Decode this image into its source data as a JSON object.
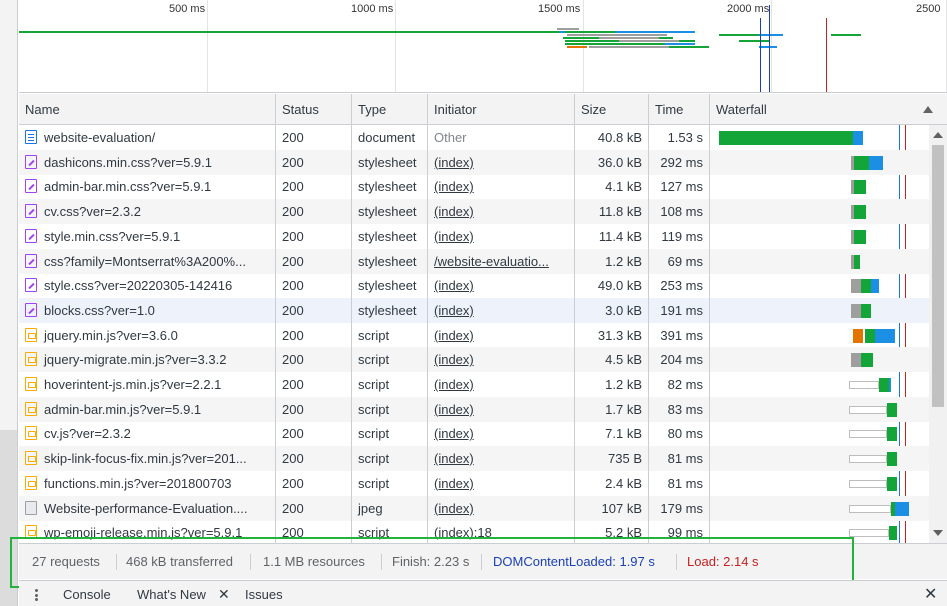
{
  "overview": {
    "ticks": [
      "500 ms",
      "1000 ms",
      "1500 ms",
      "2000 ms",
      "2500"
    ]
  },
  "columns": {
    "name": "Name",
    "status": "Status",
    "type": "Type",
    "initiator": "Initiator",
    "size": "Size",
    "time": "Time",
    "waterfall": "Waterfall"
  },
  "rows": [
    {
      "name": "website-evaluation/",
      "status": "200",
      "type": "document",
      "initiator": "Other",
      "size": "40.8 kB",
      "time": "1.53 s",
      "icon": "document-icon"
    },
    {
      "name": "dashicons.min.css?ver=5.9.1",
      "status": "200",
      "type": "stylesheet",
      "initiator": "(index)",
      "size": "36.0 kB",
      "time": "292 ms",
      "icon": "stylesheet-icon"
    },
    {
      "name": "admin-bar.min.css?ver=5.9.1",
      "status": "200",
      "type": "stylesheet",
      "initiator": "(index)",
      "size": "4.1 kB",
      "time": "127 ms",
      "icon": "stylesheet-icon"
    },
    {
      "name": "cv.css?ver=2.3.2",
      "status": "200",
      "type": "stylesheet",
      "initiator": "(index)",
      "size": "11.8 kB",
      "time": "108 ms",
      "icon": "stylesheet-icon"
    },
    {
      "name": "style.min.css?ver=5.9.1",
      "status": "200",
      "type": "stylesheet",
      "initiator": "(index)",
      "size": "11.4 kB",
      "time": "119 ms",
      "icon": "stylesheet-icon"
    },
    {
      "name": "css?family=Montserrat%3A200%...",
      "status": "200",
      "type": "stylesheet",
      "initiator": "/website-evaluatio...",
      "size": "1.2 kB",
      "time": "69 ms",
      "icon": "stylesheet-icon"
    },
    {
      "name": "style.css?ver=20220305-142416",
      "status": "200",
      "type": "stylesheet",
      "initiator": "(index)",
      "size": "49.0 kB",
      "time": "253 ms",
      "icon": "stylesheet-icon"
    },
    {
      "name": "blocks.css?ver=1.0",
      "status": "200",
      "type": "stylesheet",
      "initiator": "(index)",
      "size": "3.0 kB",
      "time": "191 ms",
      "icon": "stylesheet-icon"
    },
    {
      "name": "jquery.min.js?ver=3.6.0",
      "status": "200",
      "type": "script",
      "initiator": "(index)",
      "size": "31.3 kB",
      "time": "391 ms",
      "icon": "script-icon"
    },
    {
      "name": "jquery-migrate.min.js?ver=3.3.2",
      "status": "200",
      "type": "script",
      "initiator": "(index)",
      "size": "4.5 kB",
      "time": "204 ms",
      "icon": "script-icon"
    },
    {
      "name": "hoverintent-js.min.js?ver=2.2.1",
      "status": "200",
      "type": "script",
      "initiator": "(index)",
      "size": "1.2 kB",
      "time": "82 ms",
      "icon": "script-icon"
    },
    {
      "name": "admin-bar.min.js?ver=5.9.1",
      "status": "200",
      "type": "script",
      "initiator": "(index)",
      "size": "1.7 kB",
      "time": "83 ms",
      "icon": "script-icon"
    },
    {
      "name": "cv.js?ver=2.3.2",
      "status": "200",
      "type": "script",
      "initiator": "(index)",
      "size": "7.1 kB",
      "time": "80 ms",
      "icon": "script-icon"
    },
    {
      "name": "skip-link-focus-fix.min.js?ver=201...",
      "status": "200",
      "type": "script",
      "initiator": "(index)",
      "size": "735 B",
      "time": "81 ms",
      "icon": "script-icon"
    },
    {
      "name": "functions.min.js?ver=201800703",
      "status": "200",
      "type": "script",
      "initiator": "(index)",
      "size": "2.4 kB",
      "time": "81 ms",
      "icon": "script-icon"
    },
    {
      "name": "Website-performance-Evaluation....",
      "status": "200",
      "type": "jpeg",
      "initiator": "(index)",
      "size": "107 kB",
      "time": "179 ms",
      "icon": "image-icon"
    },
    {
      "name": "wp-emoji-release.min.js?ver=5.9.1",
      "status": "200",
      "type": "script",
      "initiator": "(index):18",
      "size": "5.2 kB",
      "time": "99 ms",
      "icon": "script-icon"
    }
  ],
  "summary": {
    "requests": "27 requests",
    "transferred": "468 kB transferred",
    "resources": "1.1 MB resources",
    "finish": "Finish: 2.23 s",
    "dom_content_loaded": "DOMContentLoaded: 1.97 s",
    "load": "Load: 2.14 s"
  },
  "drawer": {
    "tabs": [
      "Console",
      "What's New",
      "Issues"
    ]
  },
  "colors": {
    "dom_content_loaded": "#1a3fb5",
    "load": "#c5221f",
    "highlight": "#22b33a",
    "waterfall_green": "#13a538",
    "waterfall_blue": "#1a8fe3"
  }
}
